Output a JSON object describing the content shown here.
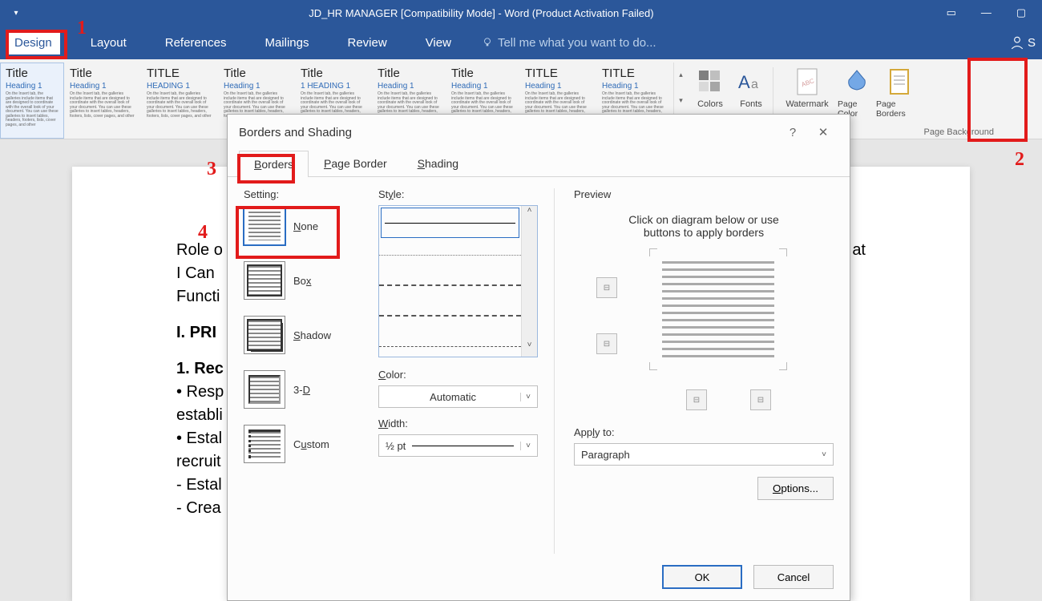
{
  "title": "JD_HR MANAGER [Compatibility Mode] - Word (Product Activation Failed)",
  "ribbon": {
    "tabs": [
      "Design",
      "Layout",
      "References",
      "Mailings",
      "Review",
      "View"
    ],
    "tellme": "Tell me what you want to do...",
    "share_initial": "S",
    "buttons": {
      "colors": "Colors",
      "fonts": "Fonts",
      "watermark": "Watermark",
      "page_color": "Page Color",
      "page_borders": "Page Borders",
      "page_background_group": "Page Background"
    },
    "styles": [
      {
        "title": "Title",
        "heading": "Heading 1",
        "sel": true,
        "w": 80
      },
      {
        "title": "Title",
        "heading": "Heading 1",
        "w": 96
      },
      {
        "title": "TITLE",
        "heading": "HEADING 1",
        "w": 96
      },
      {
        "title": "Title",
        "heading": "Heading 1",
        "w": 96
      },
      {
        "title": "Title",
        "heading": "1  HEADING 1",
        "w": 96
      },
      {
        "title": "Title",
        "heading": "Heading 1",
        "w": 92
      },
      {
        "title": "Title",
        "heading": "Heading 1",
        "w": 92
      },
      {
        "title": "TITLE",
        "heading": "Heading 1",
        "w": 96
      },
      {
        "title": "TITLE",
        "heading": "Heading 1",
        "w": 96
      }
    ]
  },
  "document": {
    "l1_left": "Role o",
    "l1_right": "at",
    "l2": "I Can",
    "l3": "Functi",
    "h1": "I. PRI",
    "h2": "1. Rec",
    "b1": "• Resp",
    "b2": "establi",
    "b3": "• Estal",
    "b4": "recruit",
    "b5": "- Estal",
    "b6": "- Crea"
  },
  "dialog": {
    "title": "Borders and Shading",
    "tabs": {
      "borders": "Borders",
      "page_border": "Page Border",
      "shading": "Shading"
    },
    "setting_label": "Setting:",
    "settings": {
      "none": "None",
      "box": "Box",
      "shadow": "Shadow",
      "threeD": "3-D",
      "custom": "Custom"
    },
    "style_label": "Style:",
    "color_label": "Color:",
    "color_value": "Automatic",
    "width_label": "Width:",
    "width_value": "½ pt",
    "preview_label": "Preview",
    "preview_hint_l1": "Click on diagram below or use",
    "preview_hint_l2": "buttons to apply borders",
    "apply_label": "Apply to:",
    "apply_value": "Paragraph",
    "options": "Options...",
    "ok": "OK",
    "cancel": "Cancel"
  },
  "annotations": {
    "n1": "1",
    "n2": "2",
    "n3": "3",
    "n4": "4"
  }
}
